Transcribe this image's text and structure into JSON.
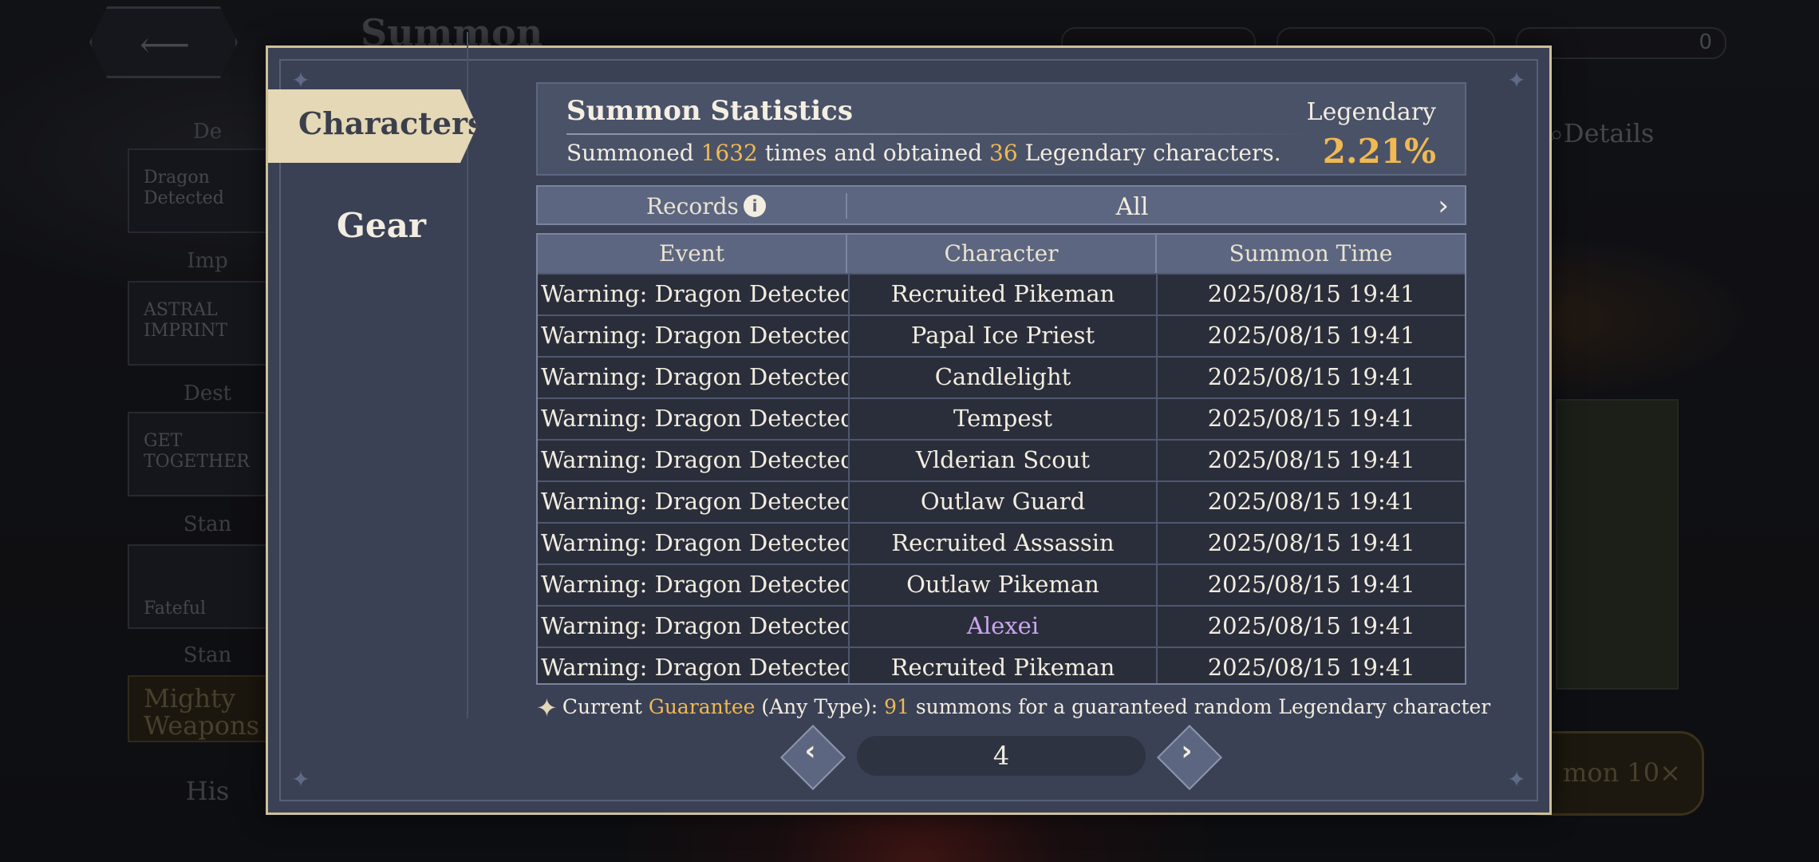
{
  "background": {
    "screen_title": "Summon",
    "resource_value": "0",
    "details_label": "Details",
    "side_labels": [
      "De",
      "Imp",
      "Dest",
      "Stan",
      "Stan"
    ],
    "side_banners": [
      "Dragon Detected",
      "ASTRAL IMPRINT",
      "GET TOGETHER",
      "Fateful",
      "Mighty Weapons"
    ],
    "history_label": "His",
    "summon_button": "mon 10×"
  },
  "tabs": {
    "characters": "Characters",
    "gear": "Gear"
  },
  "stats": {
    "title": "Summon Statistics",
    "prefix": "Summoned ",
    "count": "1632",
    "middle": " times and obtained ",
    "legendary_count": "36",
    "suffix": " Legendary characters.",
    "legendary_label": "Legendary",
    "legendary_rate": "2.21%"
  },
  "records": {
    "label": "Records",
    "info_icon": "i",
    "filter": "All",
    "arrow": "›"
  },
  "table": {
    "headers": [
      "Event",
      "Character",
      "Summon Time"
    ],
    "rows": [
      {
        "event": "Warning: Dragon Detected",
        "character": "Recruited Pikeman",
        "time": "2025/08/15 19:41"
      },
      {
        "event": "Warning: Dragon Detected",
        "character": "Papal Ice Priest",
        "time": "2025/08/15 19:41"
      },
      {
        "event": "Warning: Dragon Detected",
        "character": "Candlelight",
        "time": "2025/08/15 19:41"
      },
      {
        "event": "Warning: Dragon Detected",
        "character": "Tempest",
        "time": "2025/08/15 19:41"
      },
      {
        "event": "Warning: Dragon Detected",
        "character": "Vlderian Scout",
        "time": "2025/08/15 19:41"
      },
      {
        "event": "Warning: Dragon Detected",
        "character": "Outlaw Guard",
        "time": "2025/08/15 19:41"
      },
      {
        "event": "Warning: Dragon Detected",
        "character": "Recruited Assassin",
        "time": "2025/08/15 19:41"
      },
      {
        "event": "Warning: Dragon Detected",
        "character": "Outlaw Pikeman",
        "time": "2025/08/15 19:41"
      },
      {
        "event": "Warning: Dragon Detected",
        "character": "Alexei",
        "time": "2025/08/15 19:41",
        "color": "#c9a6f0"
      },
      {
        "event": "Warning: Dragon Detected",
        "character": "Recruited Pikeman",
        "time": "2025/08/15 19:41"
      }
    ]
  },
  "guarantee": {
    "prefix": "Current ",
    "keyword": "Guarantee",
    "middle": " (Any Type): ",
    "count": "91",
    "suffix": " summons for a guaranteed random Legendary character"
  },
  "pagination": {
    "prev": "‹",
    "page": "4",
    "next": "›"
  },
  "colors": {
    "accent_gold": "#f0b952",
    "tab_active_bg": "#e4d8b6",
    "modal_bg": "#3b4155",
    "legendary_name": "#c9a6f0"
  }
}
